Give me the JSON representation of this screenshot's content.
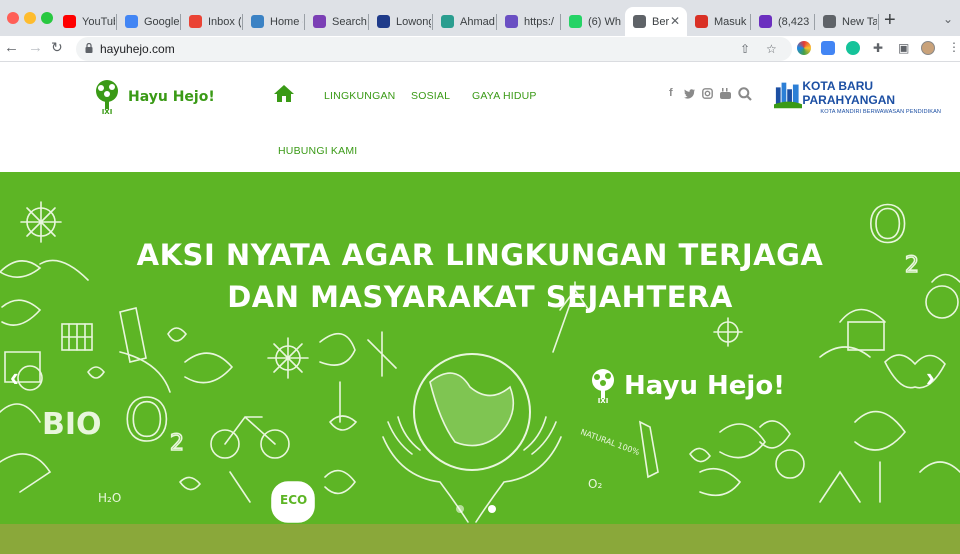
{
  "browser": {
    "tabs": [
      {
        "label": "YouTub",
        "favicon": "youtube-icon",
        "color": "#ff0000"
      },
      {
        "label": "Google",
        "favicon": "translate-icon",
        "color": "#4285f4"
      },
      {
        "label": "Inbox (",
        "favicon": "gmail-icon",
        "color": "#ea4335"
      },
      {
        "label": "Home -",
        "favicon": "canva-icon",
        "color": "#3b82c4"
      },
      {
        "label": "Search",
        "favicon": "search-app-icon",
        "color": "#7b3fb5"
      },
      {
        "label": "Lowong",
        "favicon": "job-icon",
        "color": "#1f3b8a"
      },
      {
        "label": "Ahmad",
        "favicon": "compass-icon",
        "color": "#2a9d8f"
      },
      {
        "label": "https:/",
        "favicon": "link-icon",
        "color": "#6a4fc3"
      },
      {
        "label": "(6) Wh",
        "favicon": "whatsapp-icon",
        "color": "#25d366"
      },
      {
        "label": "Ber",
        "favicon": "globe-icon",
        "color": "#5f6368"
      },
      {
        "label": "Masuk",
        "favicon": "s-icon",
        "color": "#d93025"
      },
      {
        "label": "(8,423",
        "favicon": "mail-icon",
        "color": "#6b2fbf"
      },
      {
        "label": "New Ta",
        "favicon": "chrome-icon",
        "color": "#5f6368"
      }
    ],
    "url": "hayuhejo.com"
  },
  "site": {
    "logo_text": "Hayu Hejo!",
    "nav": [
      "LINGKUNGAN",
      "SOSIAL",
      "GAYA HIDUP",
      "HUBUNGI KAMI"
    ],
    "partner_title": "KOTA BARU PARAHYANGAN",
    "partner_subtitle": "KOTA MANDIRI BERWAWASAN PENDIDIKAN",
    "social": [
      "facebook-icon",
      "twitter-icon",
      "instagram-icon",
      "youtube-icon",
      "search-icon"
    ]
  },
  "hero": {
    "line1": "AKSI NYATA AGAR LINGKUNGAN TERJAGA",
    "line2": "DAN MASYARAKAT SEJAHTERA",
    "brand": "Hayu Hejo!",
    "doodles": [
      "O",
      "2",
      "BIO",
      "O",
      "2",
      "ECO",
      "NATURAL 100%",
      "H₂O",
      "O₂"
    ],
    "bg_color": "#5db525"
  }
}
